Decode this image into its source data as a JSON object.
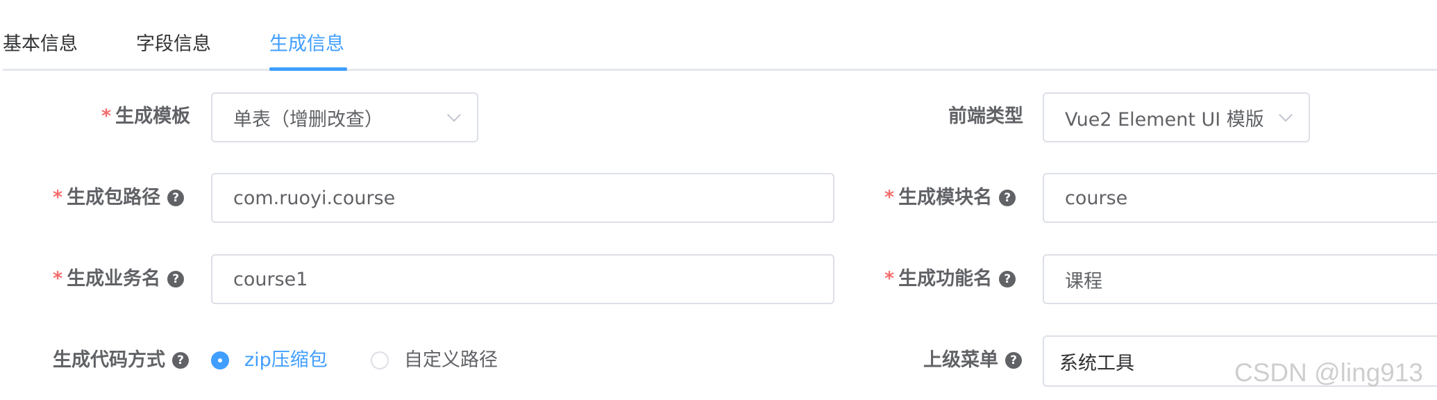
{
  "tabs": [
    "基本信息",
    "字段信息",
    "生成信息"
  ],
  "active_tab": "生成信息",
  "form": {
    "template": {
      "label": "生成模板",
      "value": "单表（增删改查）"
    },
    "frontend_type": {
      "label": "前端类型",
      "value": "Vue2 Element UI 模版"
    },
    "package_path": {
      "label": "生成包路径",
      "value": "com.ruoyi.course"
    },
    "module_name": {
      "label": "生成模块名",
      "value": "course"
    },
    "business_name": {
      "label": "生成业务名",
      "value": "course1"
    },
    "function_name": {
      "label": "生成功能名",
      "value": "课程"
    },
    "gen_type": {
      "label": "生成代码方式",
      "options": [
        "zip压缩包",
        "自定义路径"
      ],
      "selected": "zip压缩包"
    },
    "parent_menu": {
      "label": "上级菜单",
      "value": "系统工具"
    },
    "required_mark": "*",
    "help_glyph": "?"
  },
  "watermark": "CSDN @ling913",
  "colors": {
    "accent": "#409eff",
    "required": "#f56c6c",
    "label": "#606266",
    "border": "#dcdfe6"
  },
  "icons": {
    "help": "question-circle-icon",
    "dropdown": "chevron-down-icon"
  }
}
